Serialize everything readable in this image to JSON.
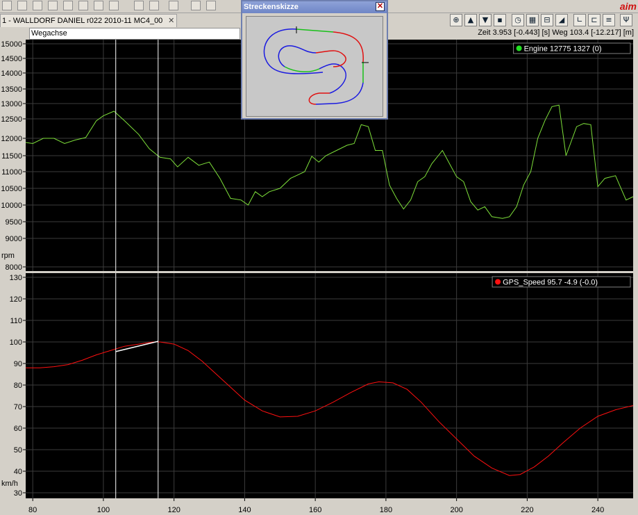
{
  "toolbar": {
    "brand": "aim"
  },
  "tab": {
    "label": "1 - WALLDORF DANIEL r022 2010-11 MC4_00",
    "close": "✕"
  },
  "info": {
    "axis_name": "Wegachse",
    "status": "Zeit 3.953 [-0.443] [s]   Weg 103.4 [-12.217] [m]"
  },
  "overlay": {
    "title": "Streckenskizze",
    "close": "✕"
  },
  "colors": {
    "background": "#000000",
    "grid": "#3c3c3c",
    "engine": "#7ee03a",
    "speed": "#ff1010",
    "cursor": "#ffffff"
  },
  "chart_data": [
    {
      "type": "line",
      "legend": {
        "label": "Engine  12775  1327  (0)",
        "placement": "top-right",
        "marker_color": "#22e022"
      },
      "ylabel": "rpm",
      "ylim": [
        8000,
        15000
      ],
      "yticks": [
        8000,
        9000,
        9500,
        10000,
        10500,
        11000,
        11500,
        12000,
        12500,
        13000,
        13500,
        14000,
        14500,
        15000
      ],
      "xlim": [
        78,
        250
      ],
      "grid": true,
      "series": [
        {
          "name": "Engine",
          "color": "#7ee03a",
          "x": [
            78,
            80,
            83,
            86,
            89,
            92,
            95,
            98,
            100,
            103,
            106,
            110,
            113,
            116,
            119,
            121,
            124,
            127,
            130,
            133,
            136,
            139,
            141,
            143,
            145,
            147,
            150,
            153,
            155,
            157,
            159,
            161,
            163,
            166,
            169,
            171,
            173,
            175,
            177,
            179,
            181,
            183,
            185,
            187,
            189,
            191,
            193,
            196,
            198,
            200,
            202,
            204,
            206,
            208,
            210,
            213,
            215,
            217,
            219,
            221,
            223,
            225,
            227,
            229,
            231,
            234,
            236,
            238,
            240,
            242,
            245,
            248,
            250
          ],
          "y": [
            11880,
            11850,
            12000,
            12000,
            11850,
            11950,
            12020,
            12450,
            12600,
            12750,
            12450,
            12100,
            11700,
            11450,
            11400,
            11150,
            11450,
            11200,
            11300,
            10800,
            10200,
            10150,
            10000,
            10400,
            10250,
            10400,
            10500,
            10800,
            10900,
            11000,
            11480,
            11300,
            11500,
            11650,
            11800,
            11850,
            12350,
            12300,
            11650,
            11650,
            10600,
            10200,
            9880,
            10150,
            10700,
            10850,
            11250,
            11650,
            11250,
            10850,
            10700,
            10100,
            9850,
            9950,
            9650,
            9600,
            9650,
            9950,
            10600,
            11000,
            12000,
            12450,
            12900,
            12950,
            11500,
            12300,
            12380,
            12350,
            10550,
            10800,
            10880,
            10150,
            10250
          ]
        }
      ],
      "cursors_x": [
        103.5,
        115.5
      ]
    },
    {
      "type": "line",
      "legend": {
        "label": "GPS_Speed  95.7  -4.9  (-0.0)",
        "placement": "top-right",
        "marker_color": "#ff1010"
      },
      "ylabel": "km/h",
      "ylim": [
        28,
        131
      ],
      "yticks": [
        30,
        40,
        50,
        60,
        70,
        80,
        90,
        100,
        110,
        120,
        130
      ],
      "xlim": [
        78,
        250
      ],
      "xticks": [
        80,
        100,
        120,
        140,
        160,
        180,
        200,
        220,
        240
      ],
      "grid": true,
      "series": [
        {
          "name": "GPS_Speed",
          "color": "#ff1010",
          "x": [
            78,
            82,
            86,
            90,
            94,
            98,
            102,
            106,
            110,
            114,
            116,
            120,
            124,
            128,
            132,
            136,
            140,
            145,
            150,
            155,
            160,
            165,
            170,
            175,
            178,
            182,
            186,
            190,
            195,
            200,
            205,
            210,
            215,
            218,
            222,
            226,
            230,
            235,
            240,
            245,
            250
          ],
          "y": [
            88,
            88,
            88.5,
            89.5,
            91.5,
            94,
            96,
            98,
            99,
            100,
            100,
            99,
            96,
            91,
            85,
            79,
            73,
            68,
            65.2,
            65.5,
            68,
            72,
            76.5,
            80.5,
            81.5,
            81,
            78,
            72,
            63,
            55,
            47,
            41.5,
            38,
            38.5,
            42,
            47,
            53,
            60,
            65.5,
            68.5,
            70.5
          ]
        },
        {
          "name": "",
          "color": "#ffffff",
          "x": [
            103.5,
            115.5
          ],
          "y": [
            95.5,
            100.3
          ]
        }
      ],
      "cursors_x": [
        103.5,
        115.5
      ]
    }
  ]
}
